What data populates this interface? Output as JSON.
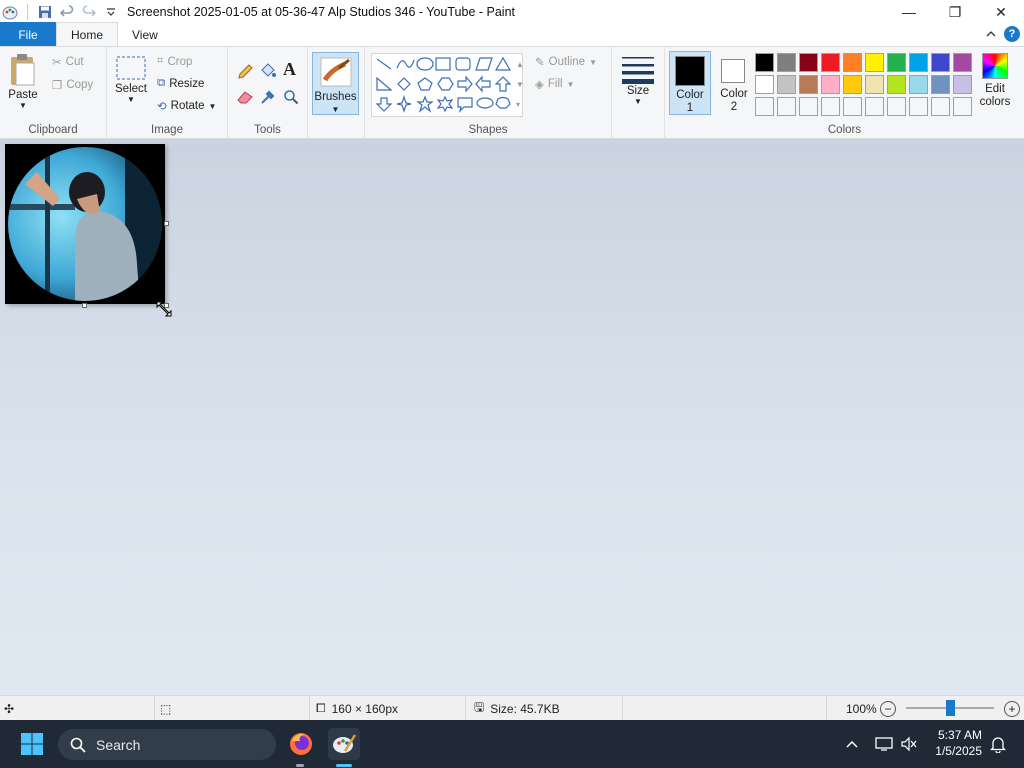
{
  "window": {
    "title": "Screenshot 2025-01-05 at 05-36-47 Alp Studios 346 - YouTube - Paint",
    "minimize": "—",
    "maximize": "❐",
    "close": "✕"
  },
  "tabs": {
    "file": "File",
    "home": "Home",
    "view": "View"
  },
  "ribbon": {
    "clipboard": {
      "label": "Clipboard",
      "paste": "Paste",
      "cut": "Cut",
      "copy": "Copy"
    },
    "image": {
      "label": "Image",
      "select": "Select",
      "crop": "Crop",
      "resize": "Resize",
      "rotate": "Rotate"
    },
    "tools": {
      "label": "Tools"
    },
    "brushes": {
      "label": "Brushes"
    },
    "shapes": {
      "label": "Shapes",
      "outline": "Outline",
      "fill": "Fill"
    },
    "size": {
      "label": "Size"
    },
    "colors": {
      "label": "Colors",
      "color1_line1": "Color",
      "color1_line2": "1",
      "color2_line1": "Color",
      "color2_line2": "2",
      "edit_line1": "Edit",
      "edit_line2": "colors",
      "palette_row1": [
        "#000000",
        "#7f7f7f",
        "#880015",
        "#ed1c24",
        "#ff7f27",
        "#fff200",
        "#22b14c",
        "#00a2e8",
        "#3f48cc",
        "#a349a4"
      ],
      "palette_row2": [
        "#ffffff",
        "#c3c3c3",
        "#b97a57",
        "#ffaec9",
        "#ffc90e",
        "#efe4b0",
        "#b5e61d",
        "#99d9ea",
        "#7092be",
        "#c8bfe7"
      ]
    }
  },
  "statusbar": {
    "dimensions": "160 × 160px",
    "size": "Size: 45.7KB",
    "zoom": "100%"
  },
  "taskbar": {
    "search": "Search",
    "time": "5:37 AM",
    "date": "1/5/2025"
  }
}
